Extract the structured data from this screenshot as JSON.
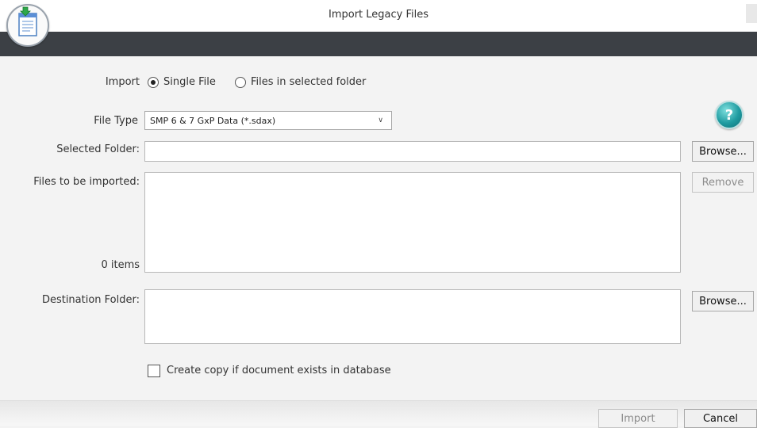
{
  "window": {
    "title": "Import Legacy Files",
    "logo_icon": "document-import-icon"
  },
  "form": {
    "import_label": "Import",
    "import_options": [
      {
        "label": "Single File",
        "checked": true
      },
      {
        "label": "Files in selected folder",
        "checked": false
      }
    ],
    "file_type_label": "File Type",
    "file_type_value": "SMP 6 & 7 GxP Data (*.sdax)",
    "selected_folder_label": "Selected Folder:",
    "selected_folder_value": "",
    "files_label": "Files to be imported:",
    "items_count": "0 items",
    "destination_label": "Destination Folder:",
    "destination_value": "",
    "copy_checkbox_label": "Create copy if document exists in database",
    "copy_checkbox_checked": false
  },
  "buttons": {
    "browse_selected": "Browse...",
    "remove": "Remove",
    "browse_destination": "Browse...",
    "import": "Import",
    "cancel": "Cancel"
  },
  "help": {
    "glyph": "?",
    "icon": "help-icon"
  },
  "colors": {
    "header_bar": "#3c4045",
    "help_accent": "#1f9ba0"
  }
}
